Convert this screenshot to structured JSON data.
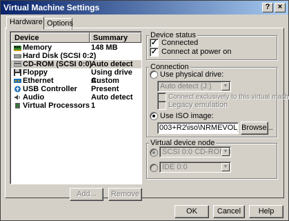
{
  "window": {
    "title": "Virtual Machine Settings",
    "close_glyph": "×",
    "help_glyph": "?"
  },
  "tabs": [
    {
      "label": "Hardware"
    },
    {
      "label": "Options"
    }
  ],
  "device_list": {
    "headers": {
      "device": "Device",
      "summary": "Summary"
    },
    "rows": [
      {
        "device": "Memory",
        "summary": "148 MB",
        "icon": "memory-icon"
      },
      {
        "device": "Hard Disk (SCSI 0:2)",
        "summary": "",
        "icon": "hard-disk-icon"
      },
      {
        "device": "CD-ROM (SCSI 0:0)",
        "summary": "Auto detect",
        "icon": "cdrom-icon"
      },
      {
        "device": "Floppy",
        "summary": "Using drive A:",
        "icon": "floppy-icon"
      },
      {
        "device": "Ethernet",
        "summary": "Custom",
        "icon": "ethernet-icon"
      },
      {
        "device": "USB Controller",
        "summary": "Present",
        "icon": "usb-icon"
      },
      {
        "device": "Audio",
        "summary": "Auto detect",
        "icon": "audio-icon"
      },
      {
        "device": "Virtual Processors",
        "summary": "1",
        "icon": "processor-icon"
      }
    ]
  },
  "list_buttons": {
    "add": "Add...",
    "remove": "Remove"
  },
  "device_status": {
    "title": "Device status",
    "connected": {
      "label": "Connected",
      "checked": true
    },
    "connect_at_power_on": {
      "label": "Connect at power on",
      "checked": true
    }
  },
  "connection": {
    "title": "Connection",
    "use_physical_drive": {
      "label": "Use physical drive:",
      "selected": false
    },
    "physical_drive_value": "Auto detect (J:)",
    "connect_exclusively": {
      "label": "Connect exclusively to this virtual machine",
      "checked": false
    },
    "legacy_emulation": {
      "label": "Legacy emulation",
      "checked": false
    },
    "use_iso_image": {
      "label": "Use ISO image:",
      "selected": true
    },
    "iso_path": "003+R2\\iso\\NRMEVOL_RU.iso",
    "browse": "Browse..."
  },
  "virtual_device_node": {
    "title": "Virtual device node",
    "scsi_value": "SCSI 0:0  CD-ROM 1",
    "ide_value": "IDE 0:0"
  },
  "footer": {
    "ok": "OK",
    "cancel": "Cancel",
    "help": "Help"
  },
  "check_glyph": "✓",
  "arrow_glyph": "▼"
}
